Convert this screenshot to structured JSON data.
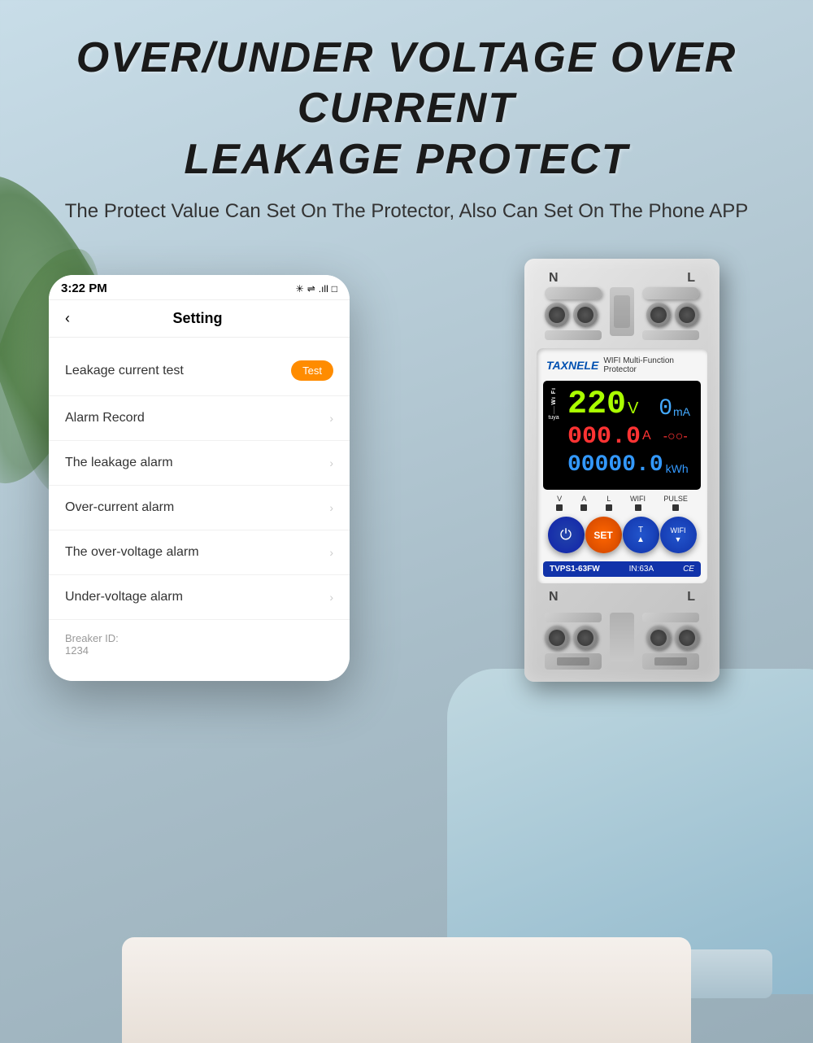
{
  "page": {
    "background_gradient": "linear-gradient(160deg, #c8dde8 0%, #b8cdd8 30%, #a8bdc8 60%, #98adb8 100%)"
  },
  "header": {
    "main_title_line1": "OVER/UNDER VOLTAGE   OVER CURRENT",
    "main_title_line2": "LEAKAGE PROTECT",
    "subtitle": "The Protect Value Can Set On The Protector, Also Can Set On The Phone APP"
  },
  "phone": {
    "status_bar": {
      "time": "3:22 PM",
      "icons": "* ⇌ .ill □"
    },
    "screen_title": "Setting",
    "back_label": "‹",
    "menu_items": [
      {
        "id": "leakage-test",
        "label": "Leakage current test",
        "action": "test-button",
        "action_label": "Test"
      },
      {
        "id": "alarm-record",
        "label": "Alarm Record",
        "action": "arrow"
      },
      {
        "id": "leakage-alarm",
        "label": "The leakage alarm",
        "action": "arrow"
      },
      {
        "id": "over-current",
        "label": "Over-current alarm",
        "action": "arrow"
      },
      {
        "id": "over-voltage",
        "label": "The over-voltage alarm",
        "action": "arrow"
      },
      {
        "id": "under-voltage",
        "label": "Under-voltage alarm",
        "action": "arrow"
      }
    ],
    "breaker_section": {
      "label": "Breaker ID:",
      "value": "1234"
    }
  },
  "device": {
    "brand": "TAXNELE",
    "brand_sub": "WIFI Multi-Function Protector",
    "connector_top_n": "N",
    "connector_top_l": "L",
    "connector_bottom_n": "N",
    "connector_bottom_l": "L",
    "lcd": {
      "voltage_value": "220",
      "voltage_unit": "V",
      "ma_value": "0",
      "ma_unit": "mA",
      "current_value": "000.0",
      "current_unit": "A",
      "kwh_value": "00000.0",
      "kwh_unit": "kWh",
      "wifi_label": "Wi Fi",
      "tuya_label": "tuya"
    },
    "indicators": [
      {
        "label": "V"
      },
      {
        "label": "A"
      },
      {
        "label": "L"
      },
      {
        "label": "WIFI"
      },
      {
        "label": "PULSE"
      }
    ],
    "buttons": [
      {
        "id": "power",
        "label": "⏻"
      },
      {
        "id": "set",
        "label": "SET"
      },
      {
        "id": "temp",
        "label": "T▲"
      },
      {
        "id": "wifi",
        "label": "WIFI▼"
      }
    ],
    "footer": {
      "model": "TVPS1-63FW",
      "rating": "IN:63A",
      "ce_mark": "CE"
    }
  }
}
